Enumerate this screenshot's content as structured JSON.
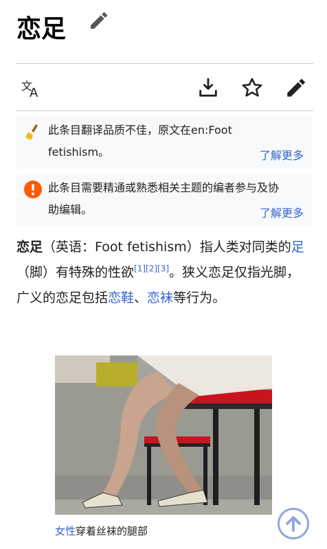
{
  "page": {
    "title": "恋足"
  },
  "notices": [
    {
      "text": "此条目翻译品质不佳，原文在en:Foot fetishism。",
      "more": "了解更多",
      "icon": "broom-icon",
      "color": "#fc3"
    },
    {
      "text": "此条目需要精通或熟悉相关主题的编者参与及协助编辑。",
      "more": "了解更多",
      "icon": "exclamation-icon",
      "color": "#fc5b00"
    }
  ],
  "article": {
    "term": "恋足",
    "p1": "（英语：Foot fetishism）指人类对同类的",
    "link_foot": "足",
    "p2": "（脚）有特殊的性欲",
    "ref1": "[1]",
    "ref2": "[2]",
    "ref3": "[3]",
    "p3": "。狭义恋足仅指光脚，广义的恋足包括",
    "link_shoes": "恋鞋",
    "sep": "、",
    "link_socks": "恋袜",
    "p4": "等行为。"
  },
  "figure": {
    "caption_link": "女性",
    "caption_text": "穿着丝袜的腿部"
  },
  "colors": {
    "link": "#3366cc",
    "text": "#202122",
    "border": "#c8ccd1",
    "notice_bg": "#f8f9fa"
  }
}
